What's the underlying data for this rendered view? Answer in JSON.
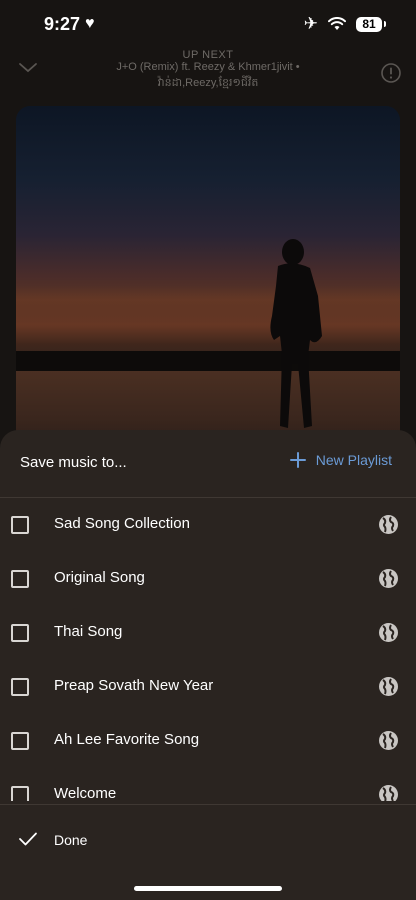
{
  "status_bar": {
    "time": "9:27",
    "battery": "81"
  },
  "now_playing": {
    "up_next_label": "UP NEXT",
    "title_line": "J+O (Remix) ft. Reezy & Khmer1jivit •",
    "artists_line": "វ៉ាន់ដា,Reezy,ខ្មែរ១ជីវិត"
  },
  "sheet": {
    "title": "Save music to...",
    "new_playlist_label": "New Playlist",
    "accent_color": "#6b9bd6",
    "playlists": [
      {
        "label": "Sad Song Collection",
        "checked": false,
        "visibility_icon": "globe-icon"
      },
      {
        "label": "Original Song",
        "checked": false,
        "visibility_icon": "globe-icon"
      },
      {
        "label": "Thai Song",
        "checked": false,
        "visibility_icon": "globe-icon"
      },
      {
        "label": "Preap Sovath New Year",
        "checked": false,
        "visibility_icon": "globe-icon"
      },
      {
        "label": "Ah Lee Favorite Song",
        "checked": false,
        "visibility_icon": "globe-icon"
      },
      {
        "label": "Welcome",
        "checked": false,
        "visibility_icon": "globe-icon"
      }
    ],
    "done_label": "Done"
  }
}
